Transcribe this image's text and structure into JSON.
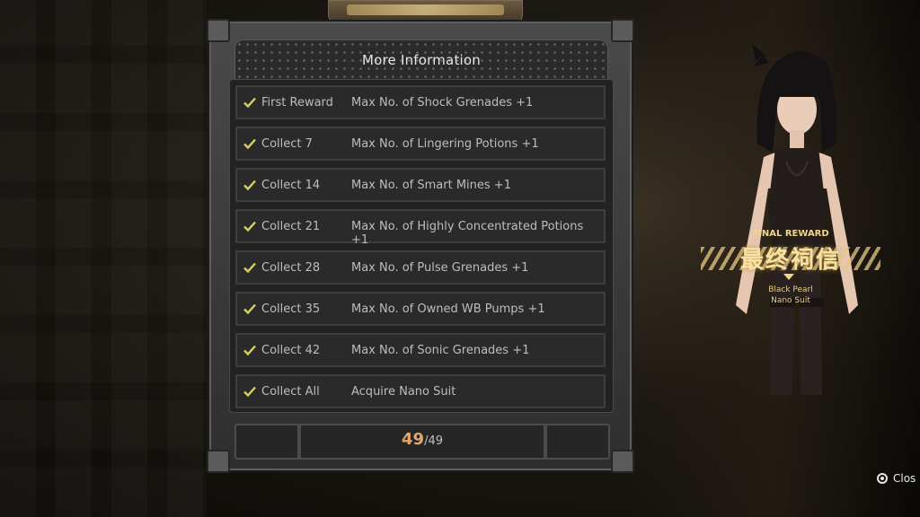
{
  "panel": {
    "title": "More Information",
    "rows": [
      {
        "label": "First Reward",
        "reward": "Max No. of Shock Grenades +1"
      },
      {
        "label": "Collect 7",
        "reward": "Max No. of Lingering Potions +1"
      },
      {
        "label": "Collect 14",
        "reward": "Max No. of Smart Mines +1"
      },
      {
        "label": "Collect 21",
        "reward": "Max No. of Highly Concentrated Potions +1"
      },
      {
        "label": "Collect 28",
        "reward": "Max No. of Pulse Grenades +1"
      },
      {
        "label": "Collect 35",
        "reward": "Max No. of Owned WB Pumps +1"
      },
      {
        "label": "Collect 42",
        "reward": "Max No. of Sonic Grenades +1"
      },
      {
        "label": "Collect All",
        "reward": "Acquire Nano Suit"
      }
    ],
    "counter": {
      "current": "49",
      "total": "/49"
    }
  },
  "final_reward": {
    "label": "FINAL REWARD",
    "chinese": "最终祠信",
    "item_line1": "Black Pearl",
    "item_line2": "Nano Suit"
  },
  "close_hint": "Clos",
  "colors": {
    "check": "#d6d06a",
    "accent": "#e0a969",
    "gold": "#f1d58d"
  }
}
